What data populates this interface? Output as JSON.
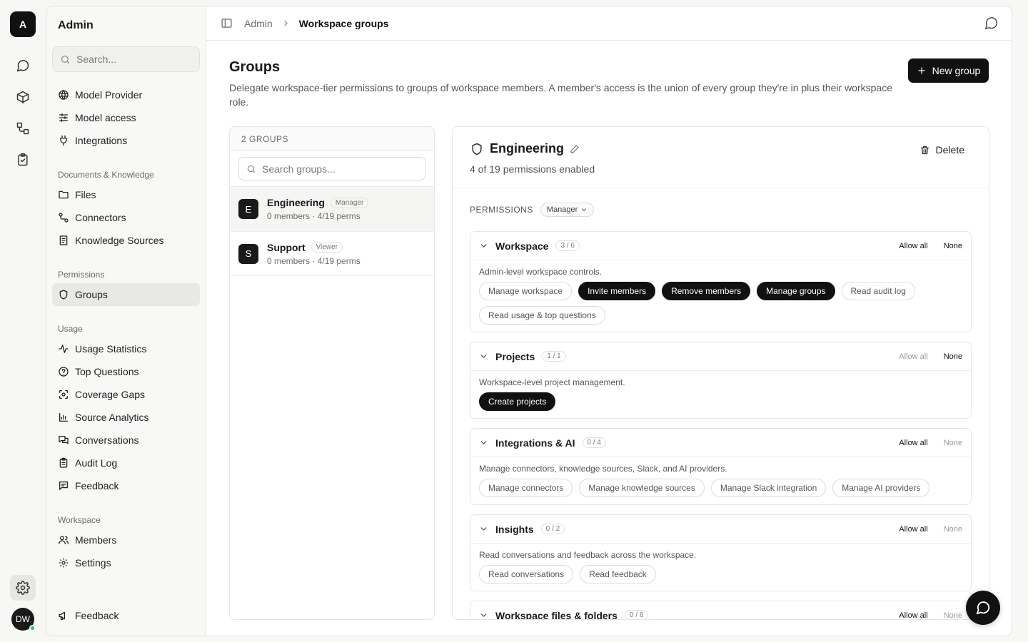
{
  "rail": {
    "logo": "A",
    "avatar": "DW",
    "icons": [
      "chat-icon",
      "box-icon",
      "connector-icon",
      "clipboard-check-icon",
      "gear-icon"
    ]
  },
  "sidebar": {
    "title": "Admin",
    "search_placeholder": "Search...",
    "items": [
      {
        "label": "Model Provider",
        "icon": "globe-icon"
      },
      {
        "label": "Model access",
        "icon": "sliders-icon"
      },
      {
        "label": "Integrations",
        "icon": "plug-icon"
      }
    ],
    "sections": [
      {
        "title": "Documents & Knowledge",
        "items": [
          {
            "label": "Files",
            "icon": "folder-icon"
          },
          {
            "label": "Connectors",
            "icon": "connector-icon"
          },
          {
            "label": "Knowledge Sources",
            "icon": "book-icon"
          }
        ]
      },
      {
        "title": "Permissions",
        "items": [
          {
            "label": "Groups",
            "icon": "shield-icon",
            "active": true
          }
        ]
      },
      {
        "title": "Usage",
        "items": [
          {
            "label": "Usage Statistics",
            "icon": "activity-icon"
          },
          {
            "label": "Top Questions",
            "icon": "help-circle-icon"
          },
          {
            "label": "Coverage Gaps",
            "icon": "scan-icon"
          },
          {
            "label": "Source Analytics",
            "icon": "bar-chart-icon"
          },
          {
            "label": "Conversations",
            "icon": "messages-icon"
          },
          {
            "label": "Audit Log",
            "icon": "clipboard-icon"
          },
          {
            "label": "Feedback",
            "icon": "message-square-icon"
          }
        ]
      },
      {
        "title": "Workspace",
        "items": [
          {
            "label": "Members",
            "icon": "users-icon"
          },
          {
            "label": "Settings",
            "icon": "gear-icon"
          }
        ]
      }
    ],
    "footer_item": {
      "label": "Feedback",
      "icon": "megaphone-icon"
    }
  },
  "topbar": {
    "breadcrumb": [
      "Admin",
      "Workspace groups"
    ]
  },
  "page": {
    "title": "Groups",
    "description": "Delegate workspace-tier permissions to groups of workspace members. A member's access is the union of every group they're in plus their workspace role.",
    "new_button": "New group"
  },
  "groups": {
    "header": "2 GROUPS",
    "search_placeholder": "Search groups...",
    "items": [
      {
        "initial": "E",
        "name": "Engineering",
        "role": "Manager",
        "meta": "0 members · 4/19 perms",
        "active": true
      },
      {
        "initial": "S",
        "name": "Support",
        "role": "Viewer",
        "meta": "0 members · 4/19 perms",
        "active": false
      }
    ]
  },
  "detail": {
    "title": "Engineering",
    "subtitle": "4 of 19 permissions enabled",
    "delete_label": "Delete",
    "permissions_label": "PERMISSIONS",
    "role_select": "Manager",
    "allow_all_label": "Allow all",
    "none_label": "None",
    "categories": [
      {
        "name": "Workspace",
        "count": "3 / 6",
        "description": "Admin-level workspace controls.",
        "allow_all_enabled": true,
        "none_enabled": true,
        "permissions": [
          {
            "label": "Manage workspace",
            "on": false
          },
          {
            "label": "Invite members",
            "on": true
          },
          {
            "label": "Remove members",
            "on": true
          },
          {
            "label": "Manage groups",
            "on": true
          },
          {
            "label": "Read audit log",
            "on": false
          },
          {
            "label": "Read usage & top questions",
            "on": false
          }
        ]
      },
      {
        "name": "Projects",
        "count": "1 / 1",
        "description": "Workspace-level project management.",
        "allow_all_enabled": false,
        "none_enabled": true,
        "permissions": [
          {
            "label": "Create projects",
            "on": true
          }
        ]
      },
      {
        "name": "Integrations & AI",
        "count": "0 / 4",
        "description": "Manage connectors, knowledge sources, Slack, and AI providers.",
        "allow_all_enabled": true,
        "none_enabled": false,
        "permissions": [
          {
            "label": "Manage connectors",
            "on": false
          },
          {
            "label": "Manage knowledge sources",
            "on": false
          },
          {
            "label": "Manage Slack integration",
            "on": false
          },
          {
            "label": "Manage AI providers",
            "on": false
          }
        ]
      },
      {
        "name": "Insights",
        "count": "0 / 2",
        "description": "Read conversations and feedback across the workspace.",
        "allow_all_enabled": true,
        "none_enabled": false,
        "permissions": [
          {
            "label": "Read conversations",
            "on": false
          },
          {
            "label": "Read feedback",
            "on": false
          }
        ]
      },
      {
        "name": "Workspace files & folders",
        "count": "0 / 6",
        "description": "",
        "allow_all_enabled": true,
        "none_enabled": false,
        "permissions": []
      }
    ]
  }
}
